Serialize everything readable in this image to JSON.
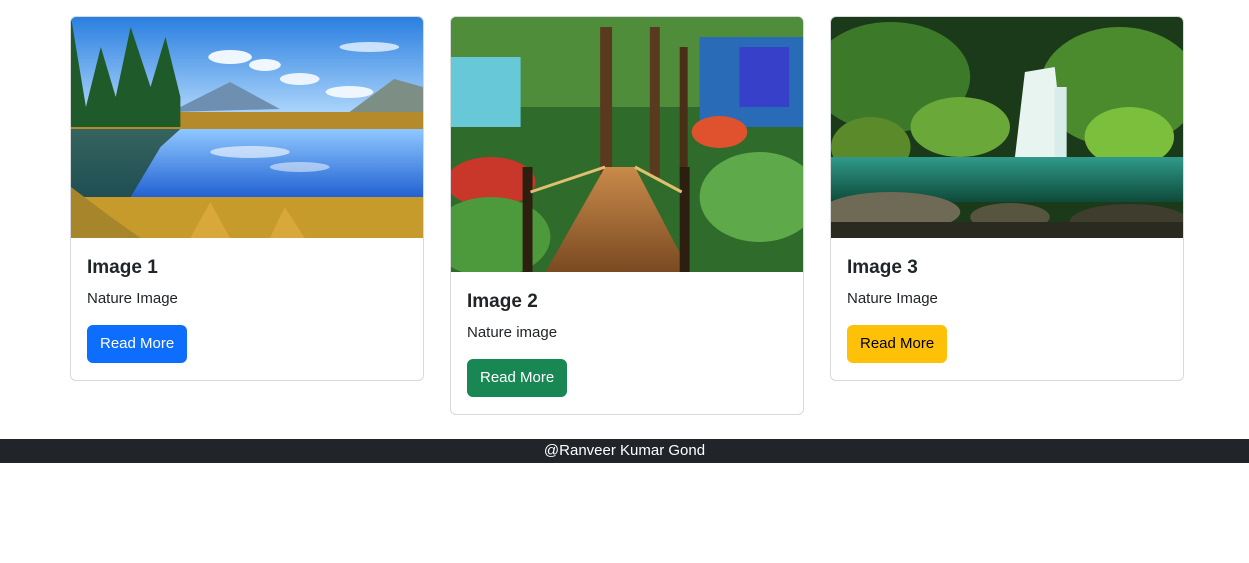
{
  "cards": [
    {
      "image": "mountain-lake-image",
      "title": "Image 1",
      "text": "Nature Image",
      "button_label": "Read More",
      "button_color": "#0d6efd"
    },
    {
      "image": "forest-bridge-image",
      "title": "Image 2",
      "text": "Nature image",
      "button_label": "Read More",
      "button_color": "#198754"
    },
    {
      "image": "waterfall-image",
      "title": "Image 3",
      "text": "Nature Image",
      "button_label": "Read More",
      "button_color": "#ffc107"
    }
  ],
  "footer": {
    "text": "@Ranveer Kumar Gond",
    "background": "#212529"
  }
}
